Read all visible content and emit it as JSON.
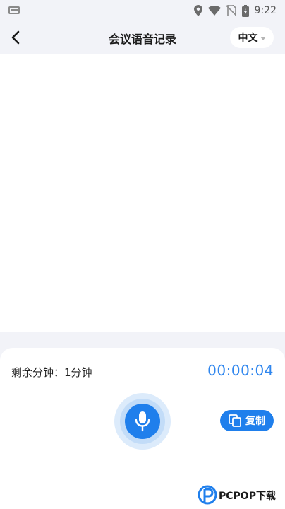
{
  "status_bar": {
    "time": "9:22",
    "icons": [
      "keyboard-icon",
      "location-icon",
      "wifi-icon",
      "no-sim-icon",
      "battery-icon"
    ]
  },
  "header": {
    "back_icon": "chevron-left-icon",
    "title": "会议语音记录",
    "language": "中文"
  },
  "transcript": {
    "text": ""
  },
  "recorder": {
    "remaining_label": "剩余分钟：1分钟",
    "elapsed": "00:00:04",
    "mic_icon": "microphone-icon",
    "copy_label": "复制",
    "copy_icon": "copy-icon"
  },
  "watermark": {
    "text": "PCPOP下载"
  },
  "colors": {
    "accent": "#1f7fec",
    "timer": "#2f86ee",
    "background": "#f2f3f8",
    "surface": "#ffffff"
  }
}
